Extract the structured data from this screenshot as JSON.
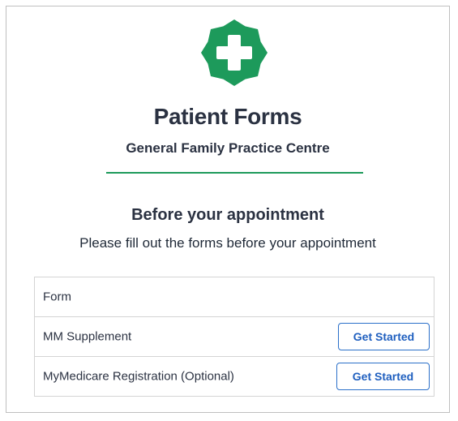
{
  "header": {
    "logo_icon": "medical-cross-badge-icon",
    "logo_color": "#1d9a5b",
    "title": "Patient Forms",
    "subtitle": "General Family Practice Centre"
  },
  "section": {
    "title": "Before your appointment",
    "description": "Please fill out the forms before your appointment"
  },
  "forms_table": {
    "header": "Form",
    "rows": [
      {
        "name": "MM Supplement",
        "action_label": "Get Started"
      },
      {
        "name": "MyMedicare Registration (Optional)",
        "action_label": "Get Started"
      }
    ]
  },
  "colors": {
    "accent": "#1d9a5b",
    "button_text": "#1f5fbf",
    "button_border": "#2a6fc9"
  }
}
